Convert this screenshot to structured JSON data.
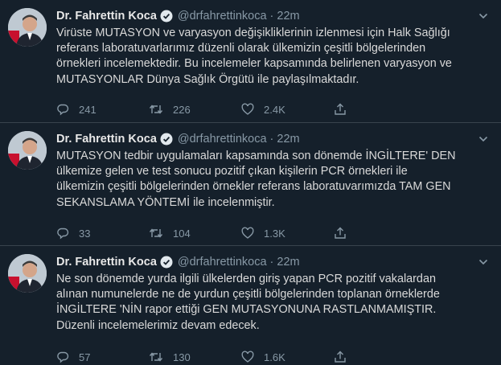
{
  "tweets": [
    {
      "author": "Dr. Fahrettin Koca",
      "handle": "@drfahrettinkoca",
      "separator": "·",
      "time": "22m",
      "text": "Virüste MUTASYON ve varyasyon değişikliklerinin izlenmesi için Halk Sağlığı\nreferans laboratuvarlarımız düzenli olarak ülkemizin çeşitli bölgelerinden\nörnekleri incelemektedir. Bu incelemeler kapsamında belirlenen varyasyon ve\nMUTASYONLAR Dünya Sağlık Örgütü ile paylaşılmaktadır.",
      "replies": "241",
      "retweets": "226",
      "likes": "2.4K"
    },
    {
      "author": "Dr. Fahrettin Koca",
      "handle": "@drfahrettinkoca",
      "separator": "·",
      "time": "22m",
      "text": "MUTASYON tedbir uygulamaları kapsamında son dönemde İNGİLTERE' DEN\nülkemize gelen ve test sonucu pozitif çıkan kişilerin PCR örnekleri ile\nülkemizin çeşitli bölgelerinden örnekler referans laboratuvarımızda TAM GEN\nSEKANSLAMA YÖNTEMİ ile incelenmiştir.",
      "replies": "33",
      "retweets": "104",
      "likes": "1.3K"
    },
    {
      "author": "Dr. Fahrettin Koca",
      "handle": "@drfahrettinkoca",
      "separator": "·",
      "time": "22m",
      "text": "Ne son dönemde yurda ilgili ülkelerden giriş yapan PCR pozitif vakalardan\nalınan numunelerde ne de yurdun çeşitli bölgelerinden toplanan örneklerde\nİNGİLTERE 'NİN rapor ettiği GEN MUTASYONUNA  RASTLANMAMIŞTIR.\nDüzenli incelemelerimiz devam edecek.",
      "replies": "57",
      "retweets": "130",
      "likes": "1.6K"
    }
  ],
  "icons": {
    "verified": "verified-badge-icon",
    "more": "chevron-down-icon",
    "reply": "reply-icon",
    "retweet": "retweet-icon",
    "like": "heart-icon",
    "share": "share-icon"
  },
  "colors": {
    "background": "#15202b",
    "text": "#d9d9d9",
    "secondary": "#8899a6",
    "verified": "#e1e8ed",
    "divider": "#38444d"
  }
}
